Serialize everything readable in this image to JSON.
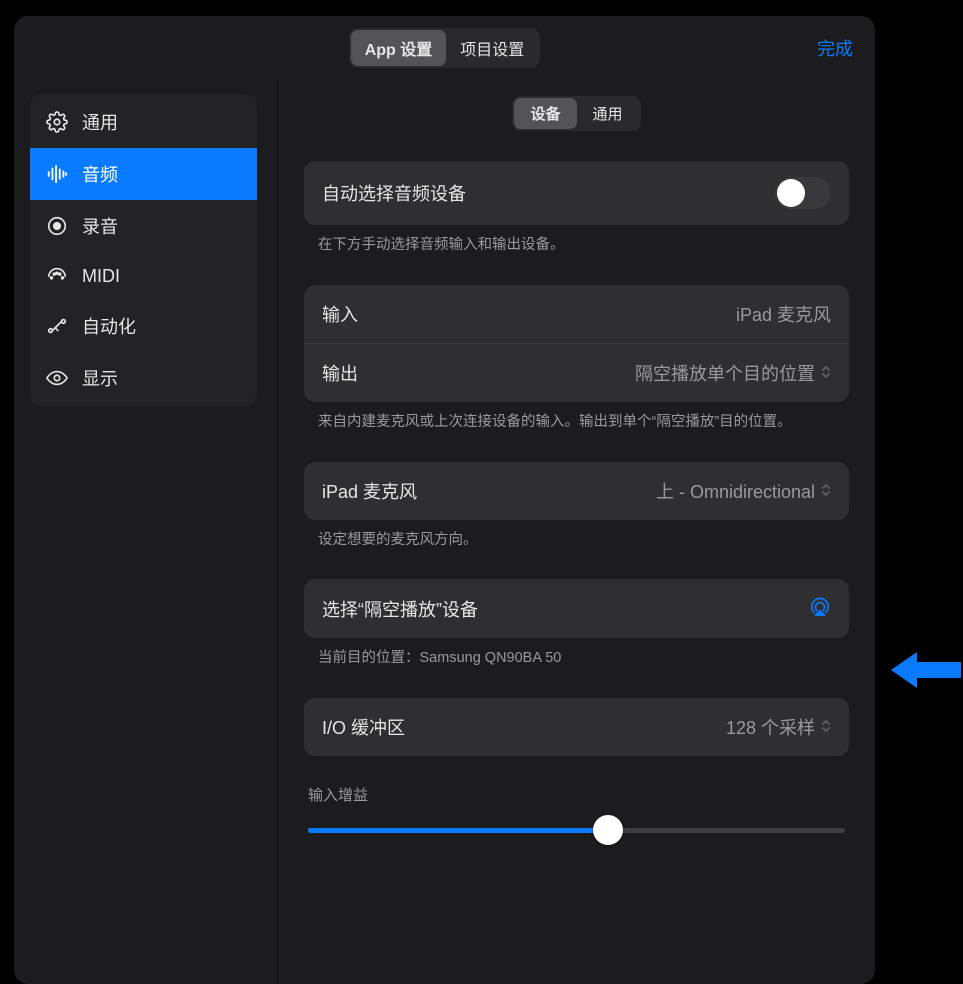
{
  "header": {
    "tabs": [
      "App 设置",
      "项目设置"
    ],
    "done": "完成"
  },
  "sidebar": {
    "items": [
      {
        "label": "通用"
      },
      {
        "label": "音频"
      },
      {
        "label": "录音"
      },
      {
        "label": "MIDI"
      },
      {
        "label": "自动化"
      },
      {
        "label": "显示"
      }
    ]
  },
  "sub_tabs": [
    "设备",
    "通用"
  ],
  "auto_select": {
    "label": "自动选择音频设备",
    "footer": "在下方手动选择音频输入和输出设备。"
  },
  "io": {
    "input_label": "输入",
    "input_value": "iPad 麦克风",
    "output_label": "输出",
    "output_value": "隔空播放单个目的位置",
    "footer": "来自内建麦克风或上次连接设备的输入。输出到单个“隔空播放”目的位置。"
  },
  "mic": {
    "label": "iPad 麦克风",
    "value": "上 - Omnidirectional",
    "footer": "设定想要的麦克风方向。"
  },
  "airplay": {
    "label": "选择“隔空播放”设备",
    "footer_prefix": "当前目的位置：",
    "footer_value": "Samsung QN90BA 50"
  },
  "buffer": {
    "label": "I/O 缓冲区",
    "value": "128 个采样"
  },
  "gain": {
    "label": "输入增益",
    "value_percent": 55
  },
  "colors": {
    "accent": "#0a7aff"
  }
}
